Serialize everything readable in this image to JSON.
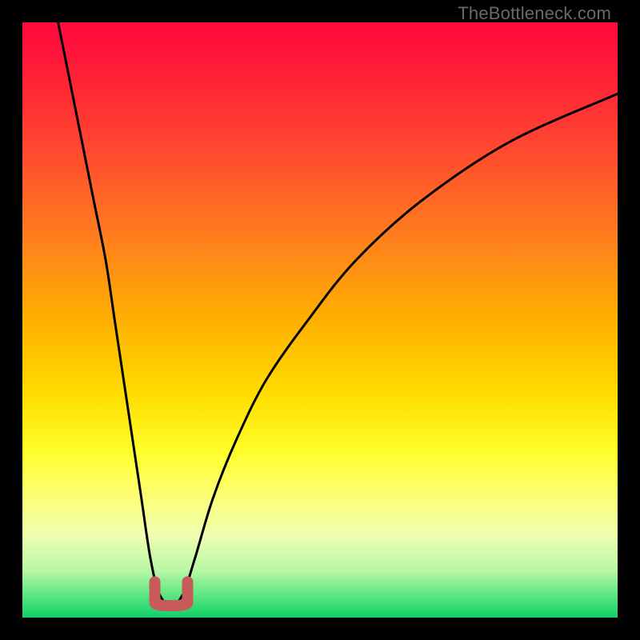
{
  "watermark": {
    "text": "TheBottleneck.com"
  },
  "chart_data": {
    "type": "line",
    "title": "",
    "xlabel": "",
    "ylabel": "",
    "xlim": [
      0,
      100
    ],
    "ylim": [
      0,
      100
    ],
    "curve": [
      {
        "x": 6.0,
        "y": 100.0
      },
      {
        "x": 8.0,
        "y": 90.0
      },
      {
        "x": 10.0,
        "y": 80.0
      },
      {
        "x": 12.0,
        "y": 70.0
      },
      {
        "x": 14.0,
        "y": 60.0
      },
      {
        "x": 15.5,
        "y": 50.0
      },
      {
        "x": 17.0,
        "y": 40.0
      },
      {
        "x": 18.5,
        "y": 30.0
      },
      {
        "x": 20.0,
        "y": 20.0
      },
      {
        "x": 21.5,
        "y": 10.0
      },
      {
        "x": 23.0,
        "y": 4.0
      },
      {
        "x": 25.0,
        "y": 2.0
      },
      {
        "x": 27.0,
        "y": 4.0
      },
      {
        "x": 29.0,
        "y": 10.0
      },
      {
        "x": 32.0,
        "y": 20.0
      },
      {
        "x": 36.0,
        "y": 30.0
      },
      {
        "x": 41.0,
        "y": 40.0
      },
      {
        "x": 48.0,
        "y": 50.0
      },
      {
        "x": 56.0,
        "y": 60.0
      },
      {
        "x": 67.0,
        "y": 70.0
      },
      {
        "x": 82.0,
        "y": 80.0
      },
      {
        "x": 100.0,
        "y": 88.0
      }
    ],
    "well_marker": {
      "x": 25.0,
      "width": 5.5,
      "depth": 6.0
    },
    "gradient_stops": [
      {
        "offset": 0.0,
        "color": "#ff0a3c"
      },
      {
        "offset": 0.05,
        "color": "#ff143a"
      },
      {
        "offset": 0.2,
        "color": "#ff4430"
      },
      {
        "offset": 0.35,
        "color": "#ff7a20"
      },
      {
        "offset": 0.5,
        "color": "#ffb000"
      },
      {
        "offset": 0.63,
        "color": "#ffde00"
      },
      {
        "offset": 0.72,
        "color": "#ffff2a"
      },
      {
        "offset": 0.79,
        "color": "#fdff70"
      },
      {
        "offset": 0.86,
        "color": "#efffb0"
      },
      {
        "offset": 0.92,
        "color": "#baf7a6"
      },
      {
        "offset": 0.96,
        "color": "#60e884"
      },
      {
        "offset": 1.0,
        "color": "#10d068"
      }
    ]
  }
}
